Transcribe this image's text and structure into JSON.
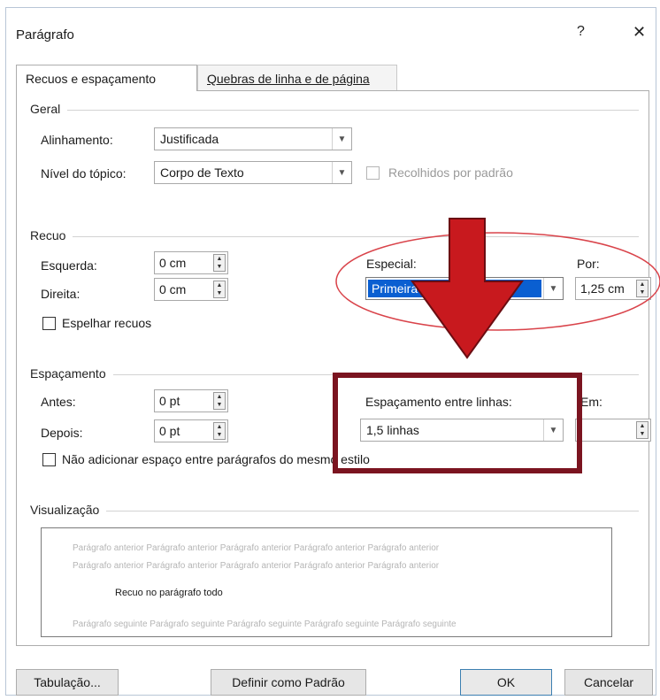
{
  "window": {
    "title": "Parágrafo",
    "help": "?",
    "close": "✕"
  },
  "tabs": [
    {
      "label": "Recuos e espaçamento"
    },
    {
      "label": "Quebras de linha e de página"
    }
  ],
  "geral": {
    "heading": "Geral",
    "alinhamento": {
      "label": "Alinhamento:",
      "value": "Justificada"
    },
    "nivel": {
      "label": "Nível do tópico:",
      "value": "Corpo de Texto"
    },
    "recolhidos": {
      "label": "Recolhidos por padrão",
      "checked": false
    }
  },
  "recuo": {
    "heading": "Recuo",
    "esquerda": {
      "label": "Esquerda:",
      "value": "0 cm"
    },
    "direita": {
      "label": "Direita:",
      "value": "0 cm"
    },
    "especial": {
      "label": "Especial:",
      "value": "Primeira"
    },
    "por": {
      "label": "Por:",
      "value": "1,25 cm"
    },
    "espelhar": {
      "label": "Espelhar recuos",
      "checked": false
    }
  },
  "espacamento": {
    "heading": "Espaçamento",
    "antes": {
      "label": "Antes:",
      "value": "0 pt"
    },
    "depois": {
      "label": "Depois:",
      "value": "0 pt"
    },
    "entre_linhas": {
      "label": "Espaçamento entre linhas:",
      "value": "1,5 linhas"
    },
    "em": {
      "label": "Em:",
      "value": ""
    },
    "nao_adicionar": {
      "label": "Não adicionar espaço entre parágrafos do mesmo estilo",
      "checked": false
    }
  },
  "visualizacao": {
    "heading": "Visualização",
    "prev_line1": "Parágrafo anterior Parágrafo anterior Parágrafo anterior Parágrafo anterior Parágrafo anterior",
    "prev_line2": "Parágrafo anterior Parágrafo anterior Parágrafo anterior Parágrafo anterior Parágrafo anterior",
    "main": "Recuo no parágrafo todo",
    "next_line": "Parágrafo seguinte Parágrafo seguinte Parágrafo seguinte Parágrafo seguinte Parágrafo seguinte"
  },
  "buttons": {
    "tabulacao": "Tabulação...",
    "definir": "Definir como Padrão",
    "ok": "OK",
    "cancelar": "Cancelar"
  },
  "annotations": {
    "arrow_color": "#c8191e",
    "ellipse_color": "#d9434a",
    "box_color": "#7b1420",
    "selection_color": "#0a5fd1"
  }
}
